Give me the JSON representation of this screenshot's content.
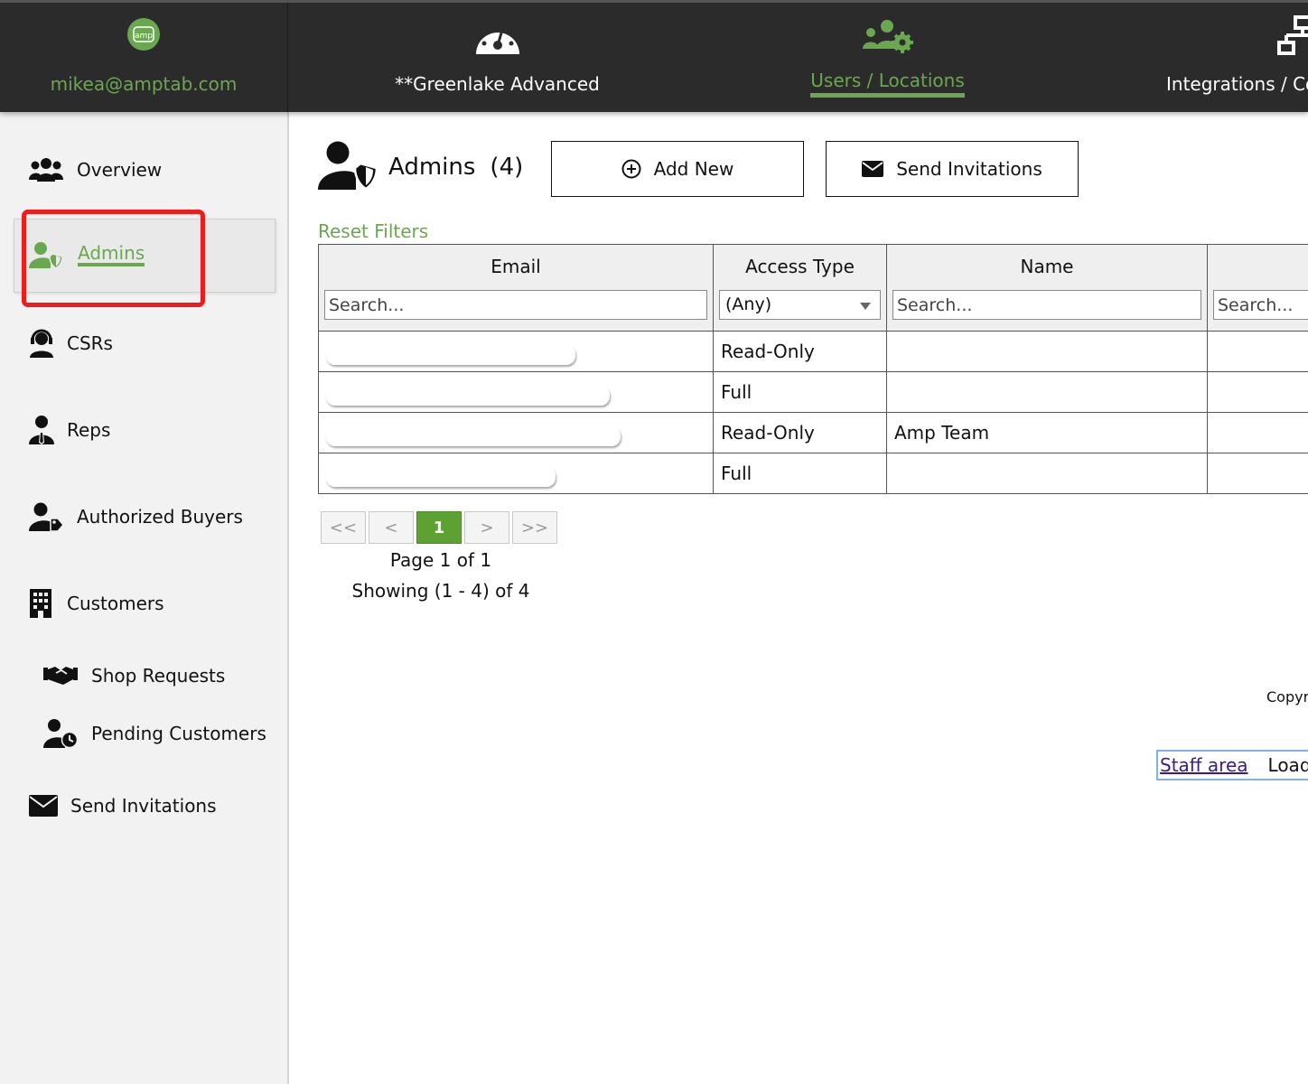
{
  "topnav": {
    "account_email": "mikea@amptab.com",
    "device_name": "**Greenlake Advanced",
    "users_locations": "Users / Locations",
    "integrations": "Integrations / Co",
    "logo_text": "amp"
  },
  "sidebar": {
    "items": [
      {
        "label": "Overview",
        "icon": "users-group-icon"
      },
      {
        "label": "Admins",
        "icon": "user-shield-icon",
        "active": true
      },
      {
        "label": "CSRs",
        "icon": "headset-user-icon"
      },
      {
        "label": "Reps",
        "icon": "user-tie-icon"
      },
      {
        "label": "Authorized Buyers",
        "icon": "user-tag-icon"
      },
      {
        "label": "Customers",
        "icon": "building-icon"
      },
      {
        "label": "Shop Requests",
        "icon": "handshake-icon"
      },
      {
        "label": "Pending Customers",
        "icon": "user-clock-icon"
      },
      {
        "label": "Send Invitations",
        "icon": "envelope-icon"
      }
    ]
  },
  "main": {
    "title": "Admins",
    "count": "(4)",
    "add_new": "Add New",
    "send_invitations": "Send Invitations",
    "reset_filters": "Reset Filters"
  },
  "table": {
    "columns": [
      "Email",
      "Access Type",
      "Name"
    ],
    "search_placeholder": "Search...",
    "access_filter": "(Any)",
    "rows": [
      {
        "access": "Read-Only",
        "name": ""
      },
      {
        "access": "Full",
        "name": ""
      },
      {
        "access": "Read-Only",
        "name": "Amp Team"
      },
      {
        "access": "Full",
        "name": ""
      }
    ]
  },
  "pagination": {
    "first": "<<",
    "prev": "<",
    "current": "1",
    "next": ">",
    "last": ">>",
    "page_text": "Page 1 of 1",
    "showing_text": "Showing (1 - 4) of 4"
  },
  "footer": {
    "copyright": "Copyr",
    "staff_area": "Staff area",
    "load": "Load t"
  },
  "colors": {
    "accent": "#6aa84f",
    "topbar": "#2b2b2b",
    "highlight": "#ee1c1c"
  }
}
